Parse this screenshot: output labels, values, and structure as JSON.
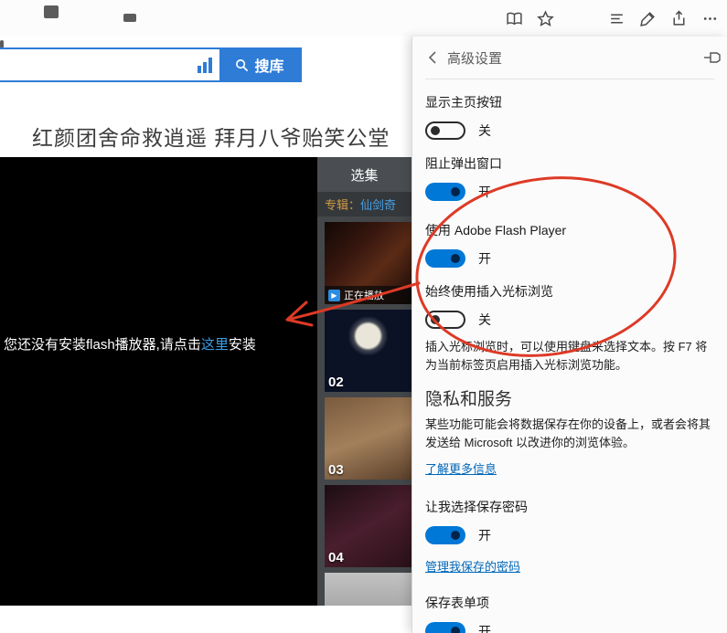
{
  "colors": {
    "accent": "#0078d7",
    "annotation_red": "#dd3a26",
    "link_blue": "#0067b8",
    "search_blue": "#2e7cd6"
  },
  "toolbar": {
    "icons": [
      "reading-view",
      "favorites",
      "hub",
      "web-note",
      "share",
      "more"
    ]
  },
  "page": {
    "search": {
      "value": "",
      "button": "搜库"
    },
    "title": "红颜团舍命救逍遥 拜月八爷贻笑公堂",
    "player": {
      "msg_before": "您还没有安装flash播放器,请点击",
      "msg_link": "这里",
      "msg_after": "安装"
    },
    "playlist": {
      "tab": "选集",
      "album_label": "专辑：",
      "album_link": "仙剑奇",
      "now_playing": "正在播放",
      "items": [
        {
          "num": ""
        },
        {
          "num": "02"
        },
        {
          "num": "03"
        },
        {
          "num": "04"
        }
      ]
    }
  },
  "settings": {
    "title": "高级设置",
    "toggles": [
      {
        "label": "显示主页按钮",
        "state": "off",
        "state_label": "关"
      },
      {
        "label": "阻止弹出窗口",
        "state": "on",
        "state_label": "开"
      },
      {
        "label": "使用 Adobe Flash Player",
        "state": "on",
        "state_label": "开"
      },
      {
        "label": "始终使用插入光标浏览",
        "state": "off",
        "state_label": "关"
      }
    ],
    "caret_note": "插入光标浏览时，可以使用键盘来选择文本。按 F7 将为当前标签页启用插入光标浏览功能。",
    "privacy_heading": "隐私和服务",
    "privacy_desc": "某些功能可能会将数据保存在你的设备上，或者会将其发送给 Microsoft 以改进你的浏览体验。",
    "learn_more": "了解更多信息",
    "save_passwords": {
      "label": "让我选择保存密码",
      "state": "on",
      "state_label": "开"
    },
    "manage_passwords": "管理我保存的密码",
    "save_form": {
      "label": "保存表单项",
      "state": "on",
      "state_label": "开"
    }
  }
}
